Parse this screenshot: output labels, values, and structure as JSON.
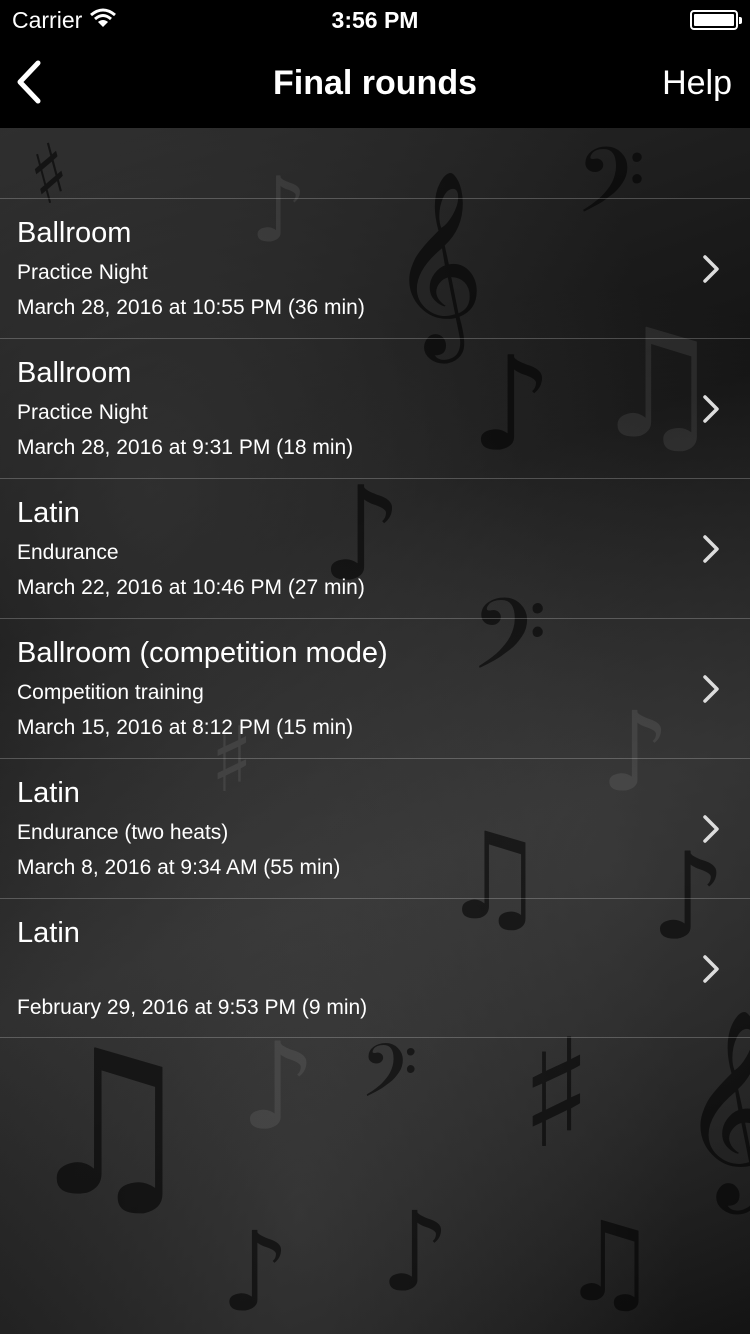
{
  "status_bar": {
    "carrier": "Carrier",
    "time": "3:56 PM"
  },
  "nav": {
    "title": "Final rounds",
    "help_label": "Help"
  },
  "rounds": [
    {
      "title": "Ballroom",
      "subtitle": "Practice Night",
      "date": "March 28, 2016 at 10:55 PM (36 min)"
    },
    {
      "title": "Ballroom",
      "subtitle": "Practice Night",
      "date": "March 28, 2016 at 9:31 PM (18 min)"
    },
    {
      "title": "Latin",
      "subtitle": "Endurance",
      "date": "March 22, 2016 at 10:46 PM (27 min)"
    },
    {
      "title": "Ballroom (competition mode)",
      "subtitle": "Competition training",
      "date": "March 15, 2016 at 8:12 PM (15 min)"
    },
    {
      "title": "Latin",
      "subtitle": "Endurance (two heats)",
      "date": "March 8, 2016 at 9:34 AM (55 min)"
    },
    {
      "title": "Latin",
      "subtitle": "",
      "date": "February 29, 2016 at 9:53 PM (9 min)"
    }
  ]
}
